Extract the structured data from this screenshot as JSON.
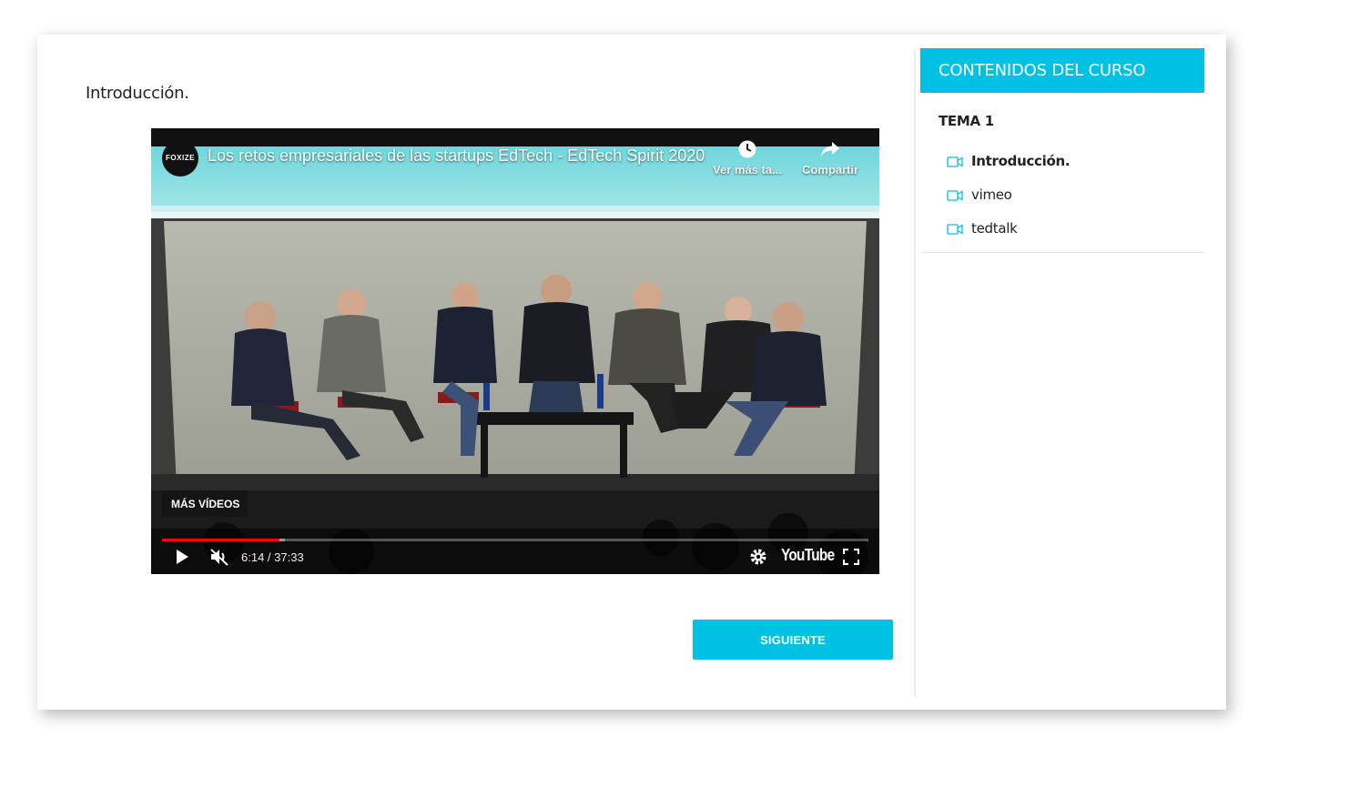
{
  "lesson": {
    "title": "Introducción."
  },
  "video": {
    "channel_logo_text": "FOXIZE",
    "title": "Los retos empresariales de las startups EdTech - EdTech Spirit 2020",
    "watch_later_label": "Ver más ta...",
    "share_label": "Compartir",
    "more_videos_label": "MÁS VÍDEOS",
    "current_time": "6:14",
    "duration": "37:33",
    "time_display": "6:14 / 37:33",
    "progress_fraction": 0.166,
    "muted": true,
    "youtube_logo_text": "YouTube",
    "icons": [
      "play-icon",
      "muted-volume-icon",
      "settings-icon",
      "fullscreen-icon",
      "clock-icon",
      "share-icon"
    ]
  },
  "navigation": {
    "next_label": "SIGUIENTE"
  },
  "sidebar": {
    "header": "CONTENIDOS DEL CURSO",
    "section_title": "TEMA 1",
    "lessons": [
      {
        "label": "Introducción.",
        "active": true,
        "icon": "video-camera-icon"
      },
      {
        "label": "vimeo",
        "active": false,
        "icon": "video-camera-icon"
      },
      {
        "label": "tedtalk",
        "active": false,
        "icon": "video-camera-icon"
      }
    ]
  },
  "colors": {
    "accent": "#00c1e2",
    "progress": "#ff0000",
    "text": "#222222"
  }
}
